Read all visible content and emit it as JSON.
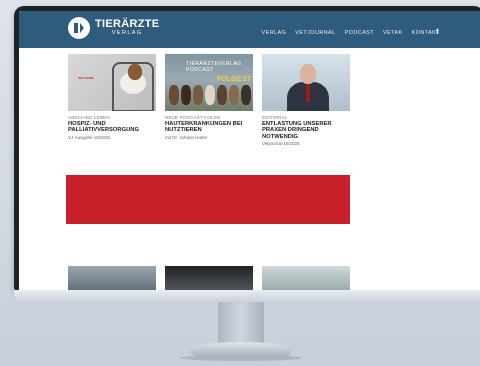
{
  "site": {
    "logo_title": "TIERÄRZTE",
    "logo_subtitle": "VERLAG"
  },
  "nav": {
    "items": [
      "VERLAG",
      "VETJOURNAL",
      "PODCAST",
      "VETAK",
      "KONTAKT"
    ],
    "social": "f"
  },
  "cards": [
    {
      "kicker": "ABSCHIED LEBEN",
      "title": "HOSPIZ- UND PALLIATIVVERSORGUNG",
      "meta": "VJ-Ausgabe 10/2025",
      "image_text": "vet cura"
    },
    {
      "kicker": "NEUE PODCAST FOLGE",
      "title": "HAUTERKRANKUNGEN BEI NUTZTIEREN",
      "meta": "mit Dr. Johann Huber",
      "image_title": "TIERÄRZTEVERLAG PODCAST",
      "image_folge": "FOLGE 27"
    },
    {
      "kicker": "EDITORIAL",
      "title": "ENTLASTUNG UNSERER PRAXEN DRINGEND NOTWENDIG",
      "meta": "Vetjournal 10/2025"
    }
  ],
  "colors": {
    "header": "#2f5b7c",
    "banner": "#c8202b"
  }
}
